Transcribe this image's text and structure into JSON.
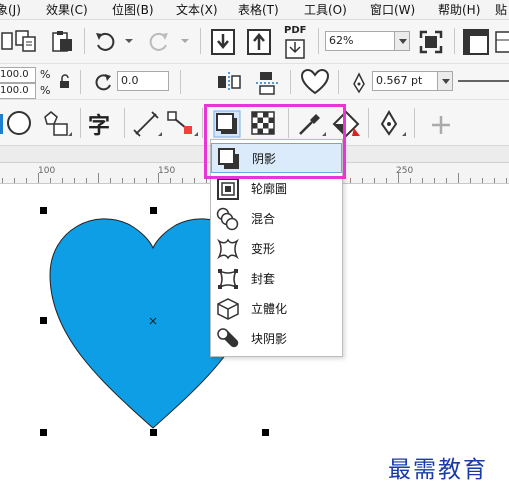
{
  "menu": [
    "象(J)",
    "效果(C)",
    "位图(B)",
    "文本(X)",
    "表格(T)",
    "工具(O)",
    "窗口(W)",
    "帮助(H)",
    "贴"
  ],
  "toolbar": {
    "pdf_label": "PDF",
    "zoom_value": "62%"
  },
  "property_bar": {
    "width_value": "100.0",
    "height_value": "100.0",
    "width_unit": "%",
    "height_unit": "%",
    "rotation_value": "0.0",
    "outline_width": "0.567 pt"
  },
  "tools": {
    "text_tool_glyph": "字"
  },
  "ruler": {
    "labels": [
      "100",
      "150",
      "250"
    ]
  },
  "flyout": {
    "items": [
      {
        "label": "阴影",
        "icon": "drop-shadow-icon",
        "selected": true
      },
      {
        "label": "轮廓圖",
        "icon": "contour-icon",
        "selected": false
      },
      {
        "label": "混合",
        "icon": "blend-icon",
        "selected": false
      },
      {
        "label": "变形",
        "icon": "distort-icon",
        "selected": false
      },
      {
        "label": "封套",
        "icon": "envelope-icon",
        "selected": false
      },
      {
        "label": "立體化",
        "icon": "extrude-icon",
        "selected": false
      },
      {
        "label": "块阴影",
        "icon": "block-shadow-icon",
        "selected": false
      }
    ]
  },
  "canvas": {
    "heart_fill": "#0d9ee6"
  },
  "colors": {
    "highlight": "#e934d6",
    "selected_item_bg": "#dcebfb",
    "watermark": "#1a3aa8"
  },
  "watermark": "最需教育"
}
